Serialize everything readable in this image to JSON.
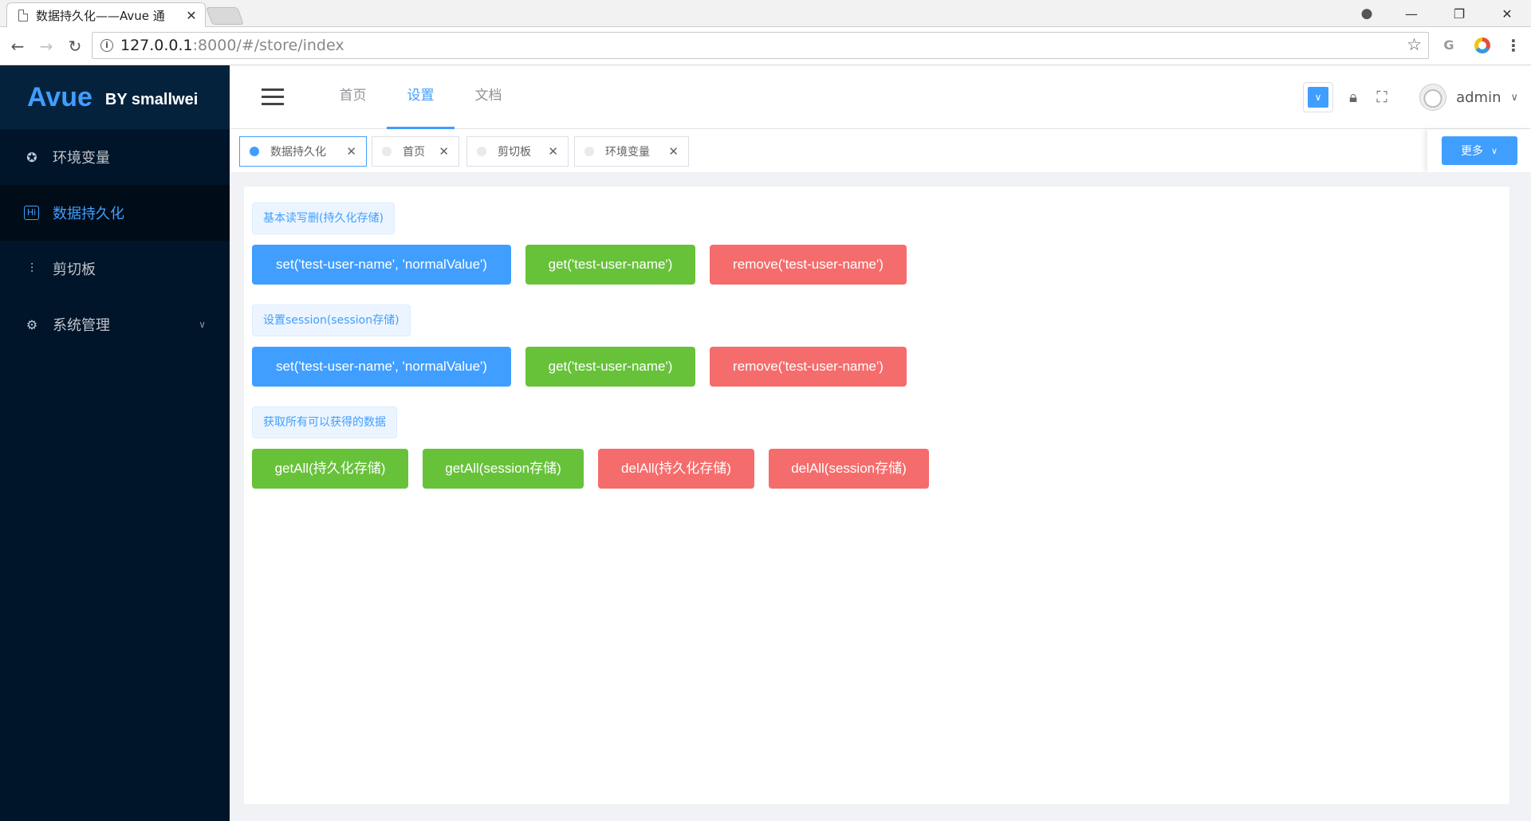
{
  "browser": {
    "tab_title": "数据持久化——Avue 通",
    "url_host": "127.0.0.1",
    "url_rest": ":8000/#/store/index"
  },
  "sidebar": {
    "logo": "Avue",
    "logo_sub": "BY smallwei",
    "items": [
      {
        "label": "环境变量",
        "icon": "star-circle-icon"
      },
      {
        "label": "数据持久化",
        "icon": "hi-badge-icon",
        "active": true
      },
      {
        "label": "剪切板",
        "icon": "sliders-icon"
      },
      {
        "label": "系统管理",
        "icon": "gear-icon",
        "expandable": true
      }
    ]
  },
  "header": {
    "nav": [
      "首页",
      "设置",
      "文档"
    ],
    "active_nav": "设置",
    "username": "admin"
  },
  "tags": {
    "items": [
      {
        "label": "数据持久化",
        "active": true
      },
      {
        "label": "首页",
        "active": false
      },
      {
        "label": "剪切板",
        "active": false
      },
      {
        "label": "环境变量",
        "active": false
      }
    ],
    "more_label": "更多"
  },
  "content": {
    "sections": [
      {
        "title": "基本读写删(持久化存储)",
        "buttons": [
          "set('test-user-name', 'normalValue')",
          "get('test-user-name')",
          "remove('test-user-name')"
        ]
      },
      {
        "title": "设置session(session存储)",
        "buttons": [
          "set('test-user-name', 'normalValue')",
          "get('test-user-name')",
          "remove('test-user-name')"
        ]
      },
      {
        "title": "获取所有可以获得的数据",
        "buttons": [
          "getAll(持久化存储)",
          "getAll(session存储)",
          "delAll(持久化存储)",
          "delAll(session存储)"
        ]
      }
    ]
  },
  "colors": {
    "primary": "#409eff",
    "success": "#67c23a",
    "danger": "#f56c6c",
    "sidebar_bg": "#001529"
  }
}
